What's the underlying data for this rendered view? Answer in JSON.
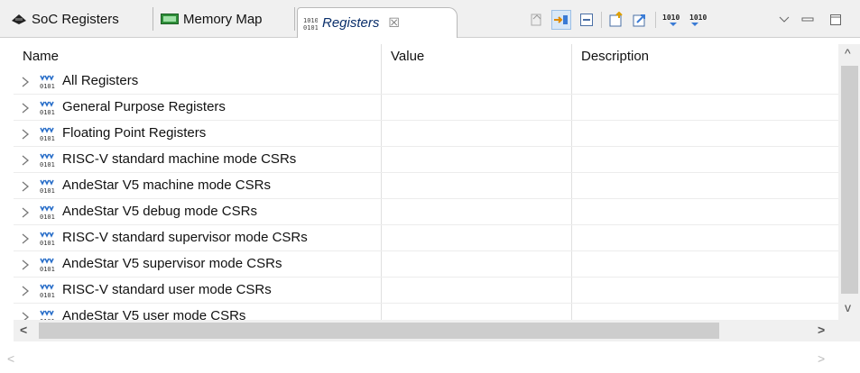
{
  "tabs": [
    {
      "label": "SoC Registers",
      "icon": "soc-chip-icon",
      "active": false
    },
    {
      "label": "Memory Map",
      "icon": "memory-map-icon",
      "active": false
    },
    {
      "label": "Registers",
      "icon": "registers-1010-icon",
      "active": true,
      "close": "☒"
    }
  ],
  "toolbar": {
    "icons": [
      "add-register-group-icon",
      "link-icon",
      "collapse-all-icon",
      "export-icon",
      "import-icon",
      "format-binary-icon",
      "format-hex-icon",
      "view-menu-icon",
      "minimize-icon",
      "maximize-icon"
    ],
    "format_labels": [
      "1010",
      "1010"
    ]
  },
  "table": {
    "columns": [
      "Name",
      "Value",
      "Description"
    ],
    "rows": [
      {
        "name": "All Registers"
      },
      {
        "name": "General Purpose Registers"
      },
      {
        "name": "Floating Point Registers"
      },
      {
        "name": "RISC-V standard machine mode CSRs"
      },
      {
        "name": "AndeStar V5 machine mode CSRs"
      },
      {
        "name": "AndeStar V5 debug mode CSRs"
      },
      {
        "name": "RISC-V standard supervisor mode CSRs"
      },
      {
        "name": "AndeStar V5 supervisor mode CSRs"
      },
      {
        "name": "RISC-V standard user mode CSRs"
      },
      {
        "name": "AndeStar V5 user mode CSRs"
      }
    ]
  },
  "scroll_arrows": {
    "up": "^",
    "down": "v",
    "left": "<",
    "right": ">"
  },
  "colors": {
    "tab_bg": "#f0f0f0",
    "active_tab_text": "#0a2f6b",
    "scroll_thumb": "#cdcdcd"
  }
}
